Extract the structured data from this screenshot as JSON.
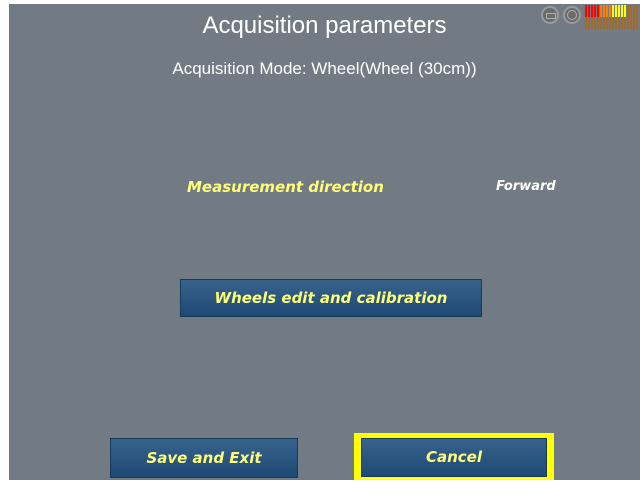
{
  "header": {
    "title": "Acquisition parameters",
    "mode_line": "Acquisition Mode: Wheel(Wheel (30cm))"
  },
  "status_icons": {
    "battery": "battery-icon",
    "network": "network-icon",
    "signal": "signal-strength-bars",
    "signal_colors": [
      "#ff0000",
      "#ff8000",
      "#ffff00",
      "#a06a2a"
    ]
  },
  "params": {
    "direction_label": "Measurement direction",
    "direction_value": "Forward"
  },
  "buttons": {
    "calibration_label": "Wheels edit and calibration",
    "save_label": "Save and Exit",
    "cancel_label": "Cancel"
  },
  "colors": {
    "background": "#727b84",
    "button": "#2b5680",
    "label_yellow": "#ffff7a",
    "focus_border": "#ffff00"
  }
}
